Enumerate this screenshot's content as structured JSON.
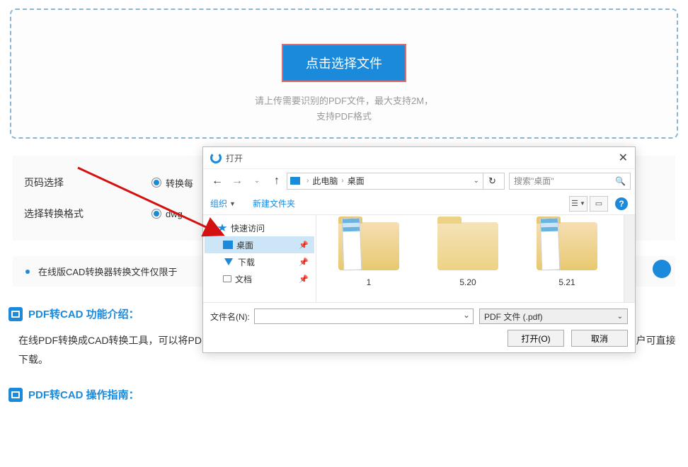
{
  "upload": {
    "button": "点击选择文件",
    "hint1": "请上传需要识别的PDF文件，最大支持2M，",
    "hint2": "支持PDF格式"
  },
  "options": {
    "page_label": "页码选择",
    "page_opt1": "转换每",
    "format_label": "选择转换格式",
    "format_opt1": "dwg"
  },
  "notice": "在线版CAD转换器转换文件仅限于",
  "sections": {
    "intro_title": "PDF转CAD 功能介绍：",
    "intro_body": "在线PDF转换成CAD转换工具，可以将PDF文档转换为CAD，用户可自定义选择要转换的PDF页码范围。PDF转换成CAD后为压缩包文件，用户可直接下载。",
    "guide_title": "PDF转CAD 操作指南："
  },
  "dialog": {
    "title": "打开",
    "path_root": "此电脑",
    "path_current": "桌面",
    "search_placeholder": "搜索\"桌面\"",
    "toolbar_organize": "组织",
    "toolbar_newfolder": "新建文件夹",
    "help_icon": "?",
    "tree": {
      "quick_access": "快速访问",
      "desktop": "桌面",
      "downloads": "下载",
      "documents": "文档"
    },
    "files": [
      {
        "name": "1",
        "preview": true
      },
      {
        "name": "5.20",
        "preview": false
      },
      {
        "name": "5.21",
        "preview": true
      }
    ],
    "filename_label": "文件名(N):",
    "filter": "PDF 文件 (.pdf)",
    "open_btn": "打开(O)",
    "cancel_btn": "取消"
  }
}
